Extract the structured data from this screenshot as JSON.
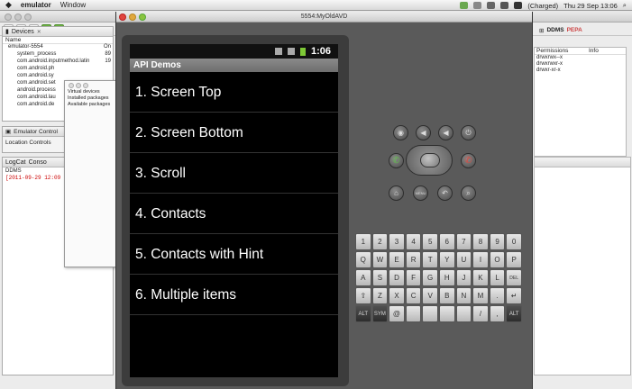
{
  "menubar": {
    "apple": "",
    "app_name": "emulator",
    "menu_window": "Window",
    "battery_status": "(Charged)",
    "datetime": "Thu 29 Sep 13:06"
  },
  "eclipse": {
    "devices_tab": "Devices",
    "devices_header": "Name",
    "devices": [
      {
        "name": "emulator-5554",
        "status": "On",
        "child": false
      },
      {
        "name": "system_process",
        "status": "89",
        "child": true
      },
      {
        "name": "com.android.inputmethod.latin",
        "status": "19",
        "child": true
      },
      {
        "name": "com.android.ph",
        "status": "",
        "child": true
      },
      {
        "name": "com.android.sy",
        "status": "",
        "child": true
      },
      {
        "name": "com.android.set",
        "status": "",
        "child": true
      },
      {
        "name": "android.process",
        "status": "",
        "child": true
      },
      {
        "name": "com.android.lau",
        "status": "",
        "child": true
      },
      {
        "name": "com.android.de",
        "status": "",
        "child": true
      }
    ],
    "popup_lines": [
      "Virtual devices",
      "Installed packages",
      "Available packages"
    ],
    "emulator_control_tab": "Emulator Control",
    "location_controls": "Location Controls",
    "logcat_tab": "LogCat",
    "console_tab": "Conso",
    "ddms_label": "DDMS",
    "log_line": "[2011-09-29 12:09",
    "perspective_ddms": "DDMS",
    "perspective_pepa": "PEPA",
    "file_columns": [
      "Permissions",
      "Info"
    ],
    "permissions": [
      "drwxrwx--x",
      "drwxrwxr-x",
      "drwxr-xr-x"
    ]
  },
  "emulator": {
    "window_title": "5554:MyOldAVD",
    "status_time": "1:06",
    "app_title": "API Demos",
    "menu_items": [
      "1. Screen Top",
      "2. Screen Bottom",
      "3. Scroll",
      "4. Contacts",
      "5. Contacts with Hint",
      "6. Multiple items"
    ],
    "keyboard_rows": [
      [
        "1",
        "2",
        "3",
        "4",
        "5",
        "6",
        "7",
        "8",
        "9",
        "0"
      ],
      [
        "Q",
        "W",
        "E",
        "R",
        "T",
        "Y",
        "U",
        "I",
        "O",
        "P"
      ],
      [
        "A",
        "S",
        "D",
        "F",
        "G",
        "H",
        "J",
        "K",
        "L",
        "DEL"
      ],
      [
        "⇧",
        "Z",
        "X",
        "C",
        "V",
        "B",
        "N",
        "M",
        ".",
        "↵"
      ],
      [
        "ALT",
        "SYM",
        "@",
        "",
        "",
        "",
        "",
        "/",
        ",",
        "ALT"
      ]
    ]
  }
}
